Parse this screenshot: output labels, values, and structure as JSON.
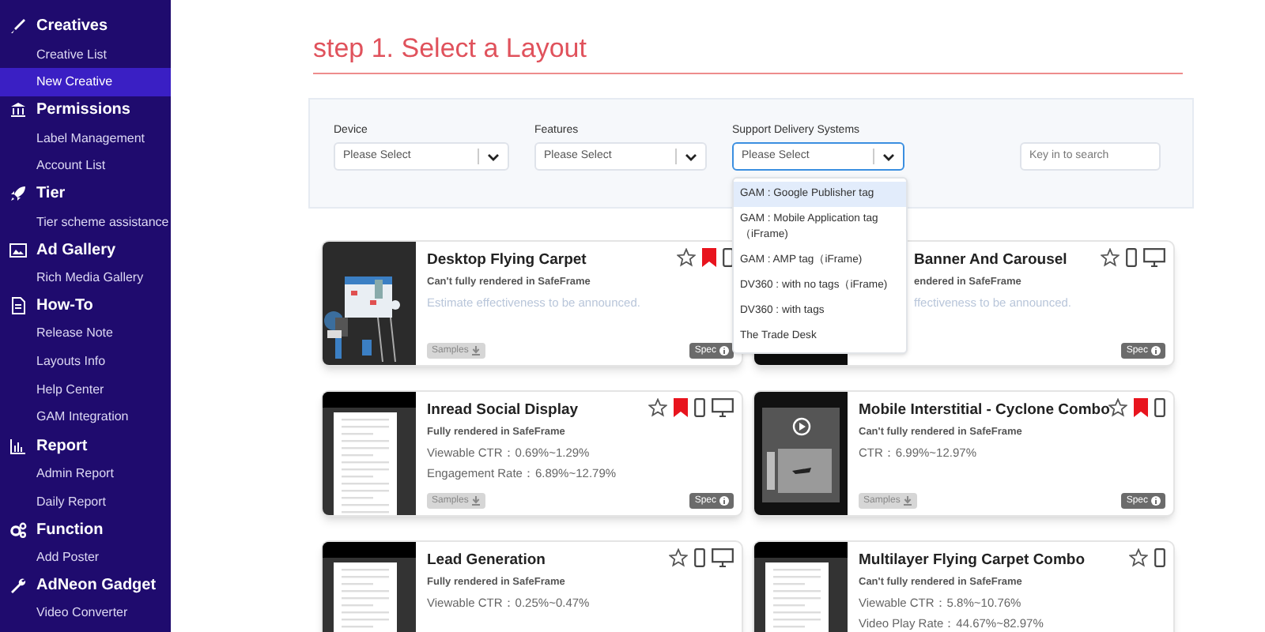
{
  "sidebar": {
    "sections": [
      {
        "label": "Creatives",
        "items": [
          {
            "label": "Creative List",
            "selected": false
          },
          {
            "label": "New Creative",
            "selected": true
          }
        ]
      },
      {
        "label": "Permissions",
        "items": [
          {
            "label": "Label Management",
            "selected": false
          },
          {
            "label": "Account List",
            "selected": false
          }
        ]
      },
      {
        "label": "Tier",
        "items": [
          {
            "label": "Tier scheme assistance",
            "selected": false
          }
        ]
      },
      {
        "label": "Ad Gallery",
        "items": [
          {
            "label": "Rich Media Gallery",
            "selected": false
          }
        ]
      },
      {
        "label": "How-To",
        "items": [
          {
            "label": "Release Note",
            "selected": false
          },
          {
            "label": "Layouts Info",
            "selected": false
          },
          {
            "label": "Help Center",
            "selected": false
          },
          {
            "label": "GAM Integration",
            "selected": false
          }
        ]
      },
      {
        "label": "Report",
        "items": [
          {
            "label": "Admin Report",
            "selected": false
          },
          {
            "label": "Daily Report",
            "selected": false
          }
        ]
      },
      {
        "label": "Function",
        "items": [
          {
            "label": "Add Poster",
            "selected": false
          }
        ]
      },
      {
        "label": "AdNeon Gadget",
        "items": [
          {
            "label": "Video Converter",
            "selected": false
          }
        ]
      }
    ]
  },
  "page_title": "step 1. Select a Layout",
  "filters": [
    {
      "label": "Device",
      "placeholder": "Please Select",
      "focused": false
    },
    {
      "label": "Features",
      "placeholder": "Please Select",
      "focused": false
    },
    {
      "label": "Support Delivery Systems",
      "placeholder": "Please Select",
      "focused": true,
      "options": [
        {
          "label": "GAM : Google Publisher tag",
          "selected": true
        },
        {
          "label": "GAM : Mobile Application tag（iFrame)",
          "selected": false
        },
        {
          "label": "GAM : AMP tag（iFrame)",
          "selected": false
        },
        {
          "label": "DV360 : with no tags（iFrame)",
          "selected": false
        },
        {
          "label": "DV360 : with tags",
          "selected": false
        },
        {
          "label": "The Trade Desk",
          "selected": false
        }
      ]
    }
  ],
  "search": {
    "placeholder": "Key in to search"
  },
  "cards": [
    {
      "covered": false,
      "title": "Desktop Flying Carpet",
      "note": "Can't fully rendered in SafeFrame",
      "stats": [
        {
          "text": "Estimate effectiveness to be announced.",
          "muted": true
        }
      ],
      "bookmarked": true,
      "desktop": false,
      "samples": "Samples",
      "spec": "Spec"
    },
    {
      "covered": true,
      "title": "Banner And Carousel",
      "note": "endered in SafeFrame",
      "stats": [
        {
          "text": "ffectiveness to be announced.",
          "muted": true
        }
      ],
      "bookmarked": false,
      "desktop": true,
      "spec": "Spec"
    },
    {
      "covered": false,
      "title": "Inread Social Display",
      "note": "Fully rendered in SafeFrame",
      "stats": [
        {
          "text": "Viewable CTR：0.69%~1.29%",
          "muted": false
        },
        {
          "text": "Engagement Rate：6.89%~12.79%",
          "muted": false
        }
      ],
      "bookmarked": true,
      "desktop": true,
      "samples": "Samples",
      "spec": "Spec"
    },
    {
      "covered": false,
      "title": "Mobile Interstitial - Cyclone Combo",
      "note": "Can't fully rendered in SafeFrame",
      "stats": [
        {
          "text": "CTR：6.99%~12.97%",
          "muted": false
        }
      ],
      "bookmarked": true,
      "desktop": false,
      "samples": "Samples",
      "spec": "Spec"
    },
    {
      "covered": false,
      "title": "Lead Generation",
      "note": "Fully rendered in SafeFrame",
      "stats": [
        {
          "text": "Viewable CTR：0.25%~0.47%",
          "muted": false
        }
      ],
      "bookmarked": false,
      "desktop": true
    },
    {
      "covered": false,
      "title": "Multilayer Flying Carpet Combo",
      "note": "Can't fully rendered in SafeFrame",
      "stats": [
        {
          "text": "Viewable CTR：5.8%~10.76%",
          "muted": false
        },
        {
          "text": "Video Play Rate：44.67%~82.97%",
          "muted": false
        }
      ],
      "bookmarked": false,
      "desktop": false
    }
  ]
}
